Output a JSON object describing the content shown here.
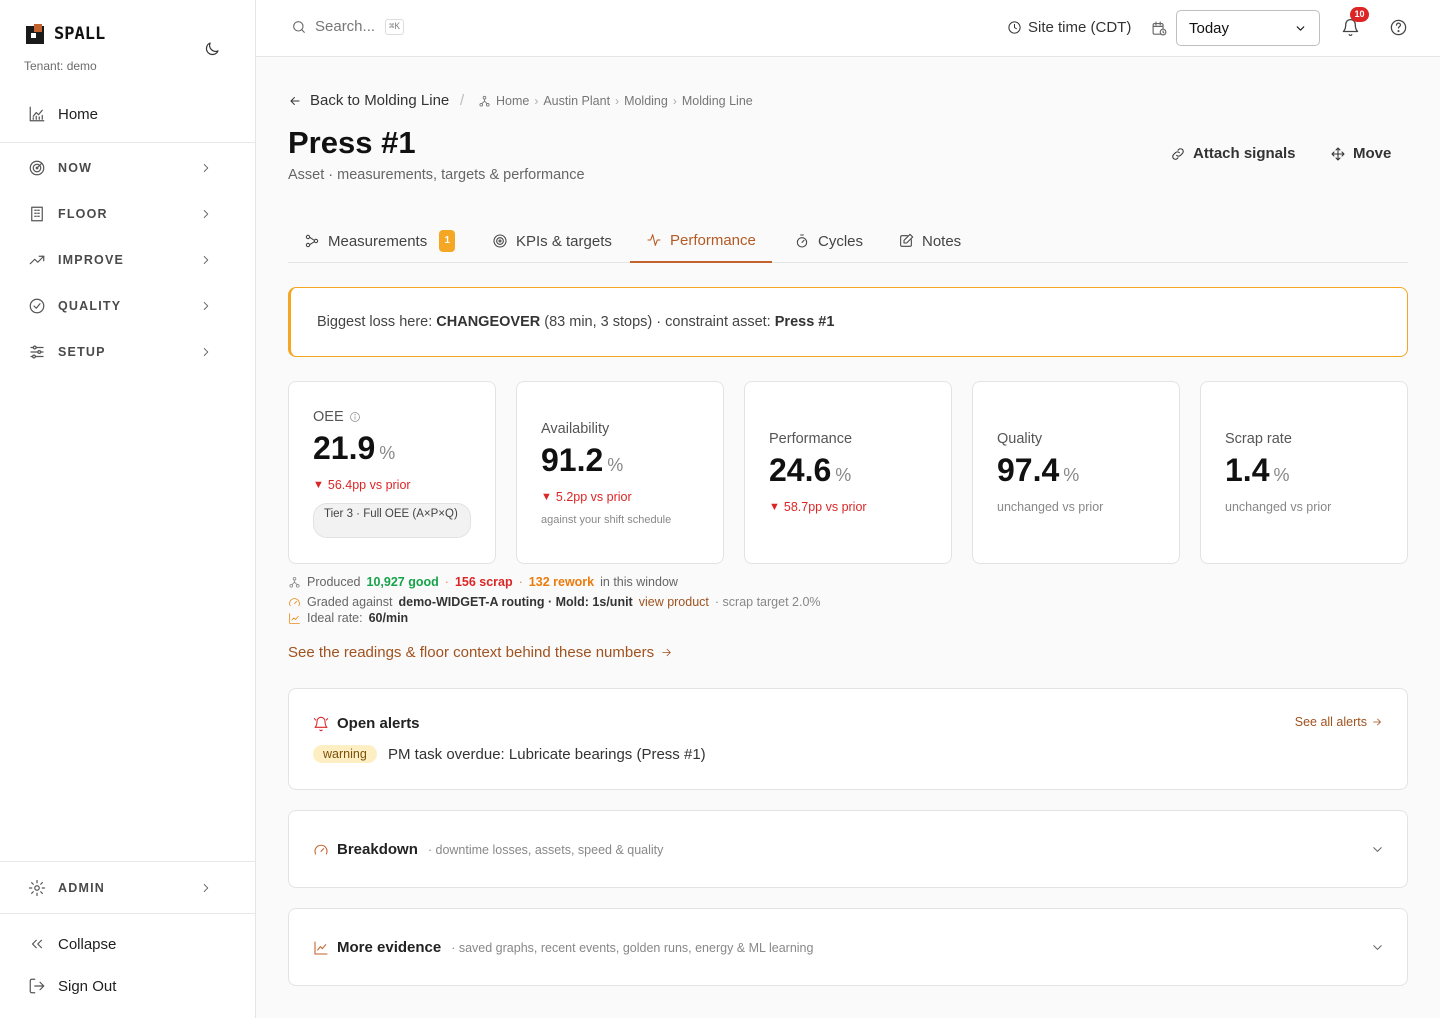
{
  "brand": {
    "name": "SPALL",
    "tenant": "Tenant: demo"
  },
  "sidebar": {
    "home": "Home",
    "items": [
      {
        "label": "NOW",
        "icon": "radar-icon"
      },
      {
        "label": "FLOOR",
        "icon": "building-icon"
      },
      {
        "label": "IMPROVE",
        "icon": "trending-up-icon"
      },
      {
        "label": "QUALITY",
        "icon": "check-circle-icon"
      },
      {
        "label": "SETUP",
        "icon": "sliders-icon"
      }
    ],
    "admin": "ADMIN",
    "collapse": "Collapse",
    "signout": "Sign Out"
  },
  "topbar": {
    "search_placeholder": "Search...",
    "search_shortcut": "⌘K",
    "site_time": "Site time (CDT)",
    "range": "Today",
    "notifications": "10"
  },
  "page": {
    "back": "Back to Molding Line",
    "breadcrumb": [
      "Home",
      "Austin Plant",
      "Molding",
      "Molding Line"
    ],
    "title": "Press #1",
    "subtitle": "Asset · measurements, targets & performance",
    "attach": "Attach signals",
    "move": "Move"
  },
  "tabs": [
    {
      "label": "Measurements",
      "badge": "1"
    },
    {
      "label": "KPIs & targets"
    },
    {
      "label": "Performance",
      "active": true
    },
    {
      "label": "Cycles"
    },
    {
      "label": "Notes"
    }
  ],
  "banner": {
    "prefix": "Biggest loss here:",
    "loss": "CHANGEOVER",
    "detail": "(83 min, 3 stops) · constraint asset:",
    "asset": "Press #1"
  },
  "kpis": {
    "oee": {
      "label": "OEE",
      "value": "21.9",
      "unit": "%",
      "delta": "56.4pp vs prior",
      "tier": "Tier 3 · Full OEE (A×P×Q)"
    },
    "availability": {
      "label": "Availability",
      "value": "91.2",
      "unit": "%",
      "delta": "5.2pp vs prior",
      "note": "against your shift schedule"
    },
    "performance": {
      "label": "Performance",
      "value": "24.6",
      "unit": "%",
      "delta": "58.7pp vs prior"
    },
    "quality": {
      "label": "Quality",
      "value": "97.4",
      "unit": "%",
      "delta": "unchanged vs prior"
    },
    "scrap": {
      "label": "Scrap rate",
      "value": "1.4",
      "unit": "%",
      "delta": "unchanged vs prior"
    }
  },
  "stats": {
    "produced_label": "Produced",
    "good": "10,927 good",
    "scrap": "156 scrap",
    "rework": "132 rework",
    "window": "in this window",
    "graded_label": "Graded against",
    "graded_value": "demo-WIDGET-A routing · Mold: 1s/unit",
    "view_product": "view product",
    "scrap_target": "· scrap target 2.0%",
    "ideal_label": "Ideal rate:",
    "ideal_value": "60/min"
  },
  "context_link": "See the readings & floor context behind these numbers",
  "alerts": {
    "title": "Open alerts",
    "see_all": "See all alerts",
    "severity": "warning",
    "text": "PM task overdue: Lubricate bearings (Press #1)"
  },
  "breakdown": {
    "title": "Breakdown",
    "subtitle": "· downtime losses, assets, speed & quality"
  },
  "evidence": {
    "title": "More evidence",
    "subtitle": "· saved graphs, recent events, golden runs, energy & ML learning"
  },
  "colors": {
    "accent": "#c2622d",
    "warning_border": "#f5a623",
    "negative": "#dc2626",
    "positive": "#16a34a"
  }
}
